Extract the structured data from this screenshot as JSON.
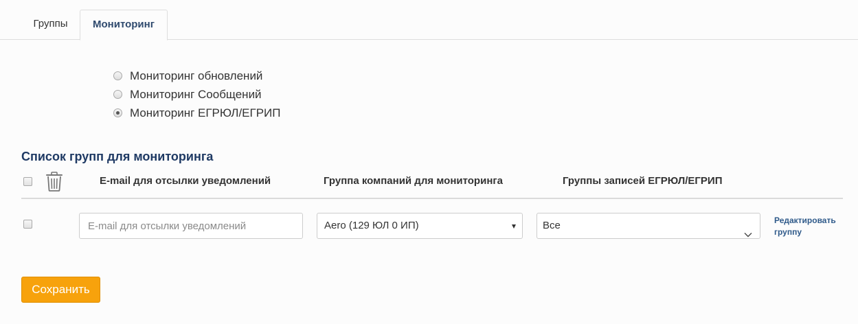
{
  "tabs": [
    {
      "label": "Группы",
      "active": false
    },
    {
      "label": "Мониторинг",
      "active": true
    }
  ],
  "monitoring_options": [
    {
      "label": "Мониторинг обновлений",
      "checked": false
    },
    {
      "label": "Мониторинг Сообщений",
      "checked": false
    },
    {
      "label": "Мониторинг ЕГРЮЛ/ЕГРИП",
      "checked": true
    }
  ],
  "section_title": "Список групп для мониторинга",
  "table": {
    "header_icon": "trash-icon",
    "columns": [
      "E-mail для отсылки уведомлений",
      "Группа компаний для мониторинга",
      "Группы записей ЕГРЮЛ/ЕГРИП"
    ],
    "rows": [
      {
        "email_value": "",
        "email_placeholder": "E-mail для отсылки уведомлений",
        "company_group": "Aero (129 ЮЛ 0 ИП)",
        "record_group": "Все",
        "edit_link": "Редактировать группу"
      }
    ]
  },
  "save_label": "Сохранить",
  "colors": {
    "accent": "#f7a20c",
    "title": "#1f3a64",
    "link": "#2f5a8a"
  }
}
